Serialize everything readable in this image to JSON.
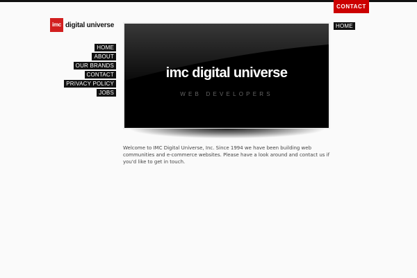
{
  "header": {
    "contact_label": "CONTACT"
  },
  "logo": {
    "mark": "imc",
    "text": "digital universe"
  },
  "nav": {
    "items": [
      {
        "label": "HOME"
      },
      {
        "label": "ABOUT"
      },
      {
        "label": "OUR BRANDS"
      },
      {
        "label": "CONTACT"
      },
      {
        "label": "PRIVACY POLICY"
      },
      {
        "label": "JOBS"
      }
    ]
  },
  "breadcrumb": {
    "label": "HOME"
  },
  "banner": {
    "title": "imc digital universe",
    "subtitle": "WEB DEVELOPERS"
  },
  "intro": {
    "text": "Welcome to IMC Digital Universe, Inc. Since 1994 we have been building web communities and e-commerce websites. Please have a look around and contact us if you'd like to get in touch."
  },
  "colors": {
    "accent": "#cc0000",
    "nav_bg": "#111111",
    "banner_bg": "#000000"
  }
}
